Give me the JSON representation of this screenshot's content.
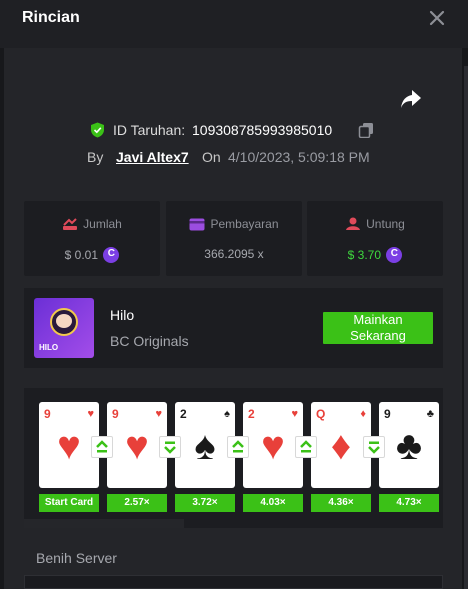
{
  "header": {
    "title": "Rincian",
    "close_icon": "close-icon"
  },
  "bet": {
    "id_label": "ID Taruhan:",
    "id_value": "109308785993985010",
    "by_label": "By",
    "username": "Javi Altex7",
    "on_label": "On",
    "date": "4/10/2023, 5:09:18 PM"
  },
  "stats": [
    {
      "label": "Jumlah",
      "value": "$ 0.01",
      "icon": "bet-amount-icon",
      "coin": true
    },
    {
      "label": "Pembayaran",
      "value": "366.2095 x",
      "icon": "payout-card-icon",
      "coin": false
    },
    {
      "label": "Untung",
      "value": "$ 3.70",
      "icon": "profit-icon",
      "coin": true
    }
  ],
  "game": {
    "name": "Hilo",
    "provider": "BC Originals",
    "thumb_label": "HILO",
    "play_label_1": "Mainkan",
    "play_label_2": "Sekarang"
  },
  "cards": [
    {
      "rank": "9",
      "suit": "♥",
      "color": "red",
      "multiplier": "Start Card"
    },
    {
      "rank": "9",
      "suit": "♥",
      "color": "red",
      "multiplier": "2.57×",
      "arrow": "up"
    },
    {
      "rank": "2",
      "suit": "♠",
      "color": "black",
      "multiplier": "3.72×",
      "arrow": "down"
    },
    {
      "rank": "2",
      "suit": "♥",
      "color": "red",
      "multiplier": "4.03×",
      "arrow": "up"
    },
    {
      "rank": "Q",
      "suit": "♦",
      "color": "red",
      "multiplier": "4.36×",
      "arrow": "up"
    },
    {
      "rank": "9",
      "suit": "♣",
      "color": "black",
      "multiplier": "4.73×",
      "arrow": "down"
    }
  ],
  "seed": {
    "label": "Benih Server"
  },
  "colors": {
    "accent_green": "#3bc117",
    "coin_purple": "#7b3fe4",
    "panel": "#242529",
    "card_bg": "#1c1d21"
  }
}
